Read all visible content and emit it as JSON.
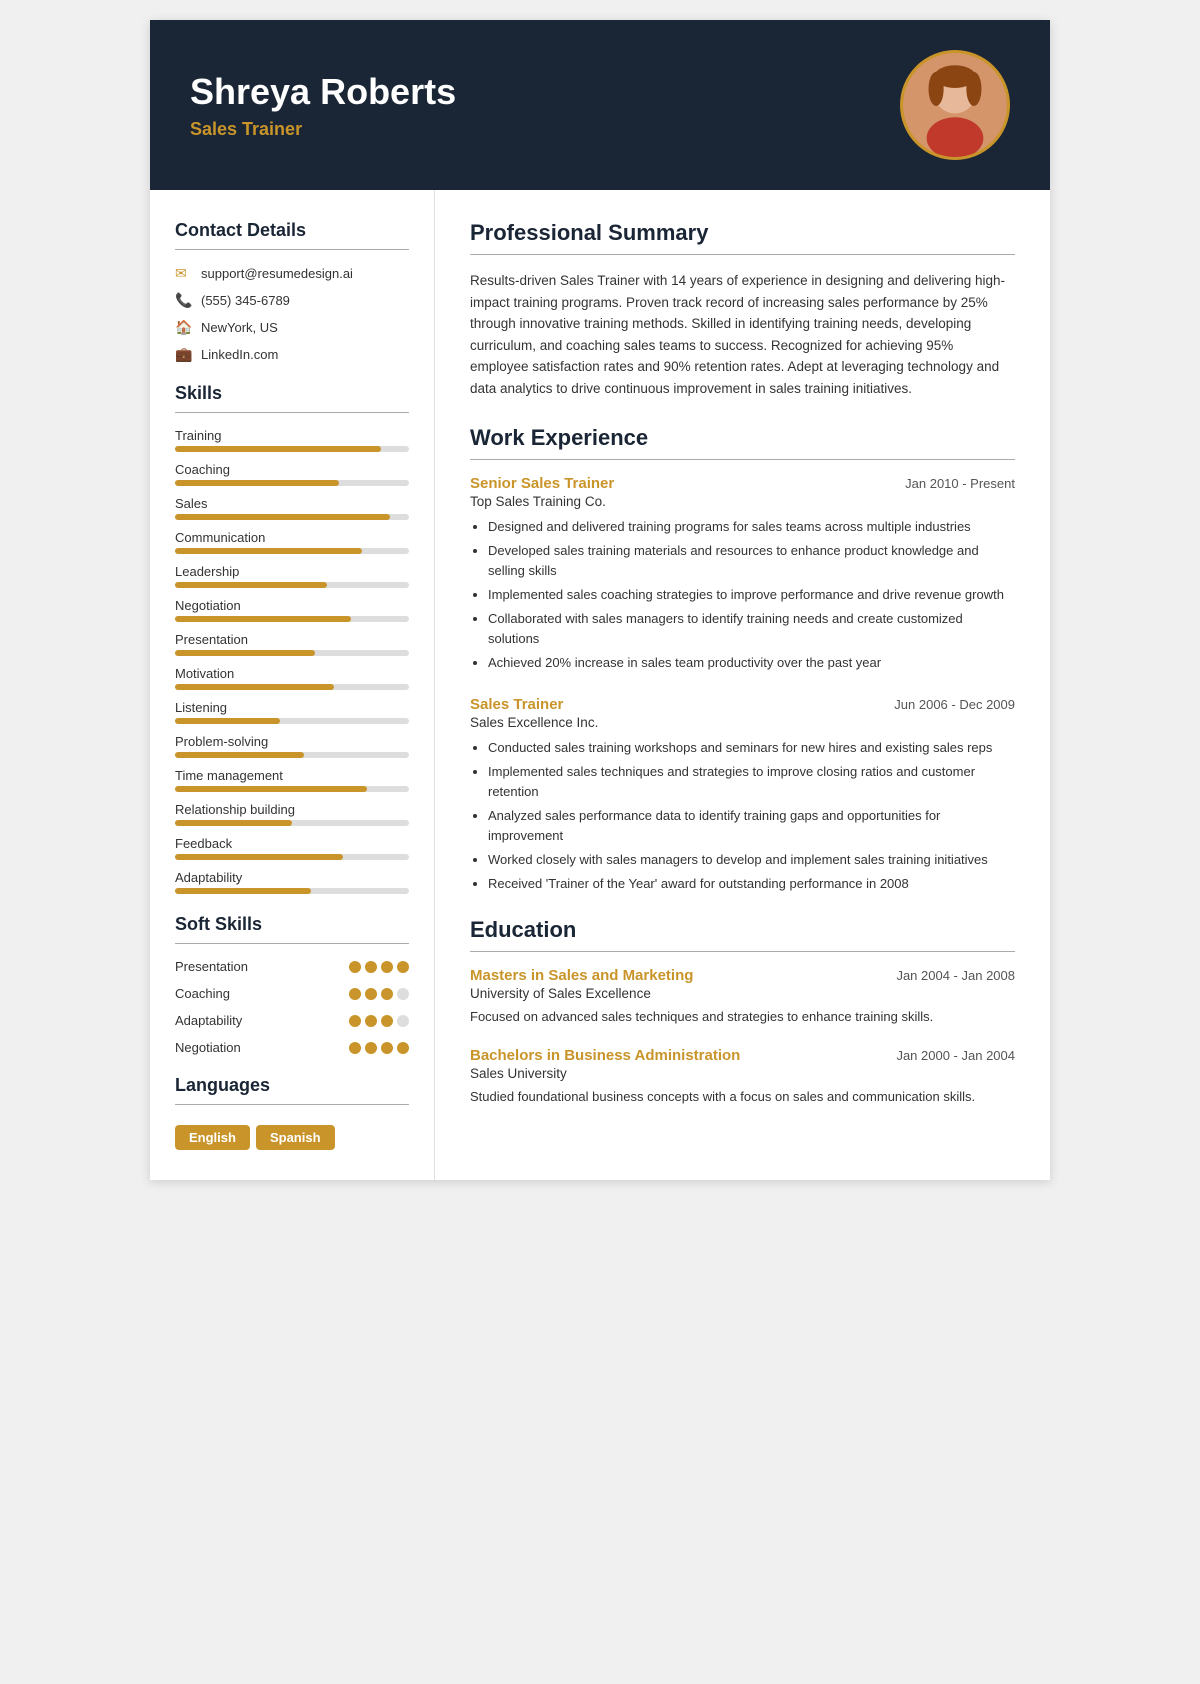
{
  "header": {
    "name": "Shreya Roberts",
    "title": "Sales Trainer",
    "photo_alt": "Profile photo"
  },
  "sidebar": {
    "contact_section_title": "Contact Details",
    "contact": [
      {
        "icon": "✉",
        "value": "support@resumedesign.ai",
        "type": "email"
      },
      {
        "icon": "📞",
        "value": "(555) 345-6789",
        "type": "phone"
      },
      {
        "icon": "🏠",
        "value": "NewYork, US",
        "type": "location"
      },
      {
        "icon": "💼",
        "value": "LinkedIn.com",
        "type": "linkedin"
      }
    ],
    "skills_section_title": "Skills",
    "skills": [
      {
        "name": "Training",
        "pct": 88
      },
      {
        "name": "Coaching",
        "pct": 70
      },
      {
        "name": "Sales",
        "pct": 92
      },
      {
        "name": "Communication",
        "pct": 80
      },
      {
        "name": "Leadership",
        "pct": 65
      },
      {
        "name": "Negotiation",
        "pct": 75
      },
      {
        "name": "Presentation",
        "pct": 60
      },
      {
        "name": "Motivation",
        "pct": 68
      },
      {
        "name": "Listening",
        "pct": 45
      },
      {
        "name": "Problem-solving",
        "pct": 55
      },
      {
        "name": "Time management",
        "pct": 82
      },
      {
        "name": "Relationship building",
        "pct": 50
      },
      {
        "name": "Feedback",
        "pct": 72
      },
      {
        "name": "Adaptability",
        "pct": 58
      }
    ],
    "soft_skills_section_title": "Soft Skills",
    "soft_skills": [
      {
        "name": "Presentation",
        "filled": 4,
        "total": 4
      },
      {
        "name": "Coaching",
        "filled": 3,
        "total": 4
      },
      {
        "name": "Adaptability",
        "filled": 3,
        "total": 4
      },
      {
        "name": "Negotiation",
        "filled": 4,
        "total": 4
      }
    ],
    "languages_section_title": "Languages",
    "languages": [
      "English",
      "Spanish"
    ]
  },
  "main": {
    "summary_section_title": "Professional Summary",
    "summary_text": "Results-driven Sales Trainer with 14 years of experience in designing and delivering high-impact training programs. Proven track record of increasing sales performance by 25% through innovative training methods. Skilled in identifying training needs, developing curriculum, and coaching sales teams to success. Recognized for achieving 95% employee satisfaction rates and 90% retention rates. Adept at leveraging technology and data analytics to drive continuous improvement in sales training initiatives.",
    "experience_section_title": "Work Experience",
    "experiences": [
      {
        "title": "Senior Sales Trainer",
        "date": "Jan 2010 - Present",
        "company": "Top Sales Training Co.",
        "bullets": [
          "Designed and delivered training programs for sales teams across multiple industries",
          "Developed sales training materials and resources to enhance product knowledge and selling skills",
          "Implemented sales coaching strategies to improve performance and drive revenue growth",
          "Collaborated with sales managers to identify training needs and create customized solutions",
          "Achieved 20% increase in sales team productivity over the past year"
        ]
      },
      {
        "title": "Sales Trainer",
        "date": "Jun 2006 - Dec 2009",
        "company": "Sales Excellence Inc.",
        "bullets": [
          "Conducted sales training workshops and seminars for new hires and existing sales reps",
          "Implemented sales techniques and strategies to improve closing ratios and customer retention",
          "Analyzed sales performance data to identify training gaps and opportunities for improvement",
          "Worked closely with sales managers to develop and implement sales training initiatives",
          "Received 'Trainer of the Year' award for outstanding performance in 2008"
        ]
      }
    ],
    "education_section_title": "Education",
    "education": [
      {
        "degree": "Masters in Sales and Marketing",
        "date": "Jan 2004 - Jan 2008",
        "school": "University of Sales Excellence",
        "desc": "Focused on advanced sales techniques and strategies to enhance training skills."
      },
      {
        "degree": "Bachelors in Business Administration",
        "date": "Jan 2000 - Jan 2004",
        "school": "Sales University",
        "desc": "Studied foundational business concepts with a focus on sales and communication skills."
      }
    ]
  }
}
